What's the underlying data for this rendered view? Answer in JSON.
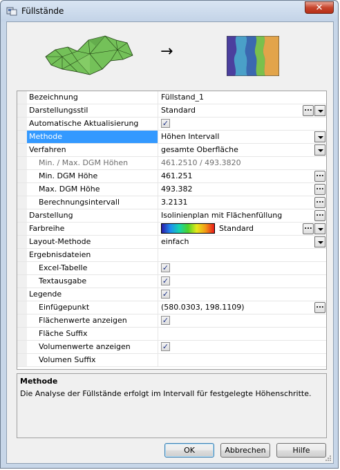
{
  "window": {
    "title": "Füllstände",
    "close_label": "✕"
  },
  "preview": {
    "arrow": "→"
  },
  "properties": [
    {
      "label": "Bezeichnung",
      "value": "Füllstand_1"
    },
    {
      "label": "Darstellungsstil",
      "value": "Standard"
    },
    {
      "label": "Automatische Aktualisierung",
      "checked": true
    },
    {
      "label": "Methode",
      "value": "Höhen Intervall"
    },
    {
      "label": "Verfahren",
      "value": "gesamte Oberfläche"
    },
    {
      "label": "Min. / Max. DGM Höhen",
      "value": "461.2510 / 493.3820"
    },
    {
      "label": "Min. DGM Höhe",
      "value": "461.251"
    },
    {
      "label": "Max. DGM Höhe",
      "value": "493.382"
    },
    {
      "label": "Berechnungsintervall",
      "value": "3.2131"
    },
    {
      "label": "Darstellung",
      "value": "Isolinienplan mit Flächenfüllung"
    },
    {
      "label": "Farbreihe",
      "value": "Standard"
    },
    {
      "label": "Layout-Methode",
      "value": "einfach"
    },
    {
      "label": "Ergebnisdateien",
      "value": ""
    },
    {
      "label": "Excel-Tabelle",
      "checked": true
    },
    {
      "label": "Textausgabe",
      "checked": true
    },
    {
      "label": "Legende",
      "checked": true
    },
    {
      "label": "Einfügepunkt",
      "value": "(580.0303, 198.1109)"
    },
    {
      "label": "Flächenwerte anzeigen",
      "checked": true
    },
    {
      "label": "Fläche Suffix",
      "value": ""
    },
    {
      "label": "Volumenwerte anzeigen",
      "checked": true
    },
    {
      "label": "Volumen Suffix",
      "value": ""
    }
  ],
  "selected_property": "Methode",
  "description": {
    "title": "Methode",
    "text": "Die Analyse der Füllstände erfolgt im Intervall für festgelegte Höhenschritte."
  },
  "buttons": {
    "ok": "OK",
    "cancel": "Abbrechen",
    "help": "Hilfe",
    "ellipsis": "..."
  },
  "check_mark": "✓",
  "colors": {
    "selection": "#3399ff",
    "terrain_green": "#6ab04c"
  }
}
